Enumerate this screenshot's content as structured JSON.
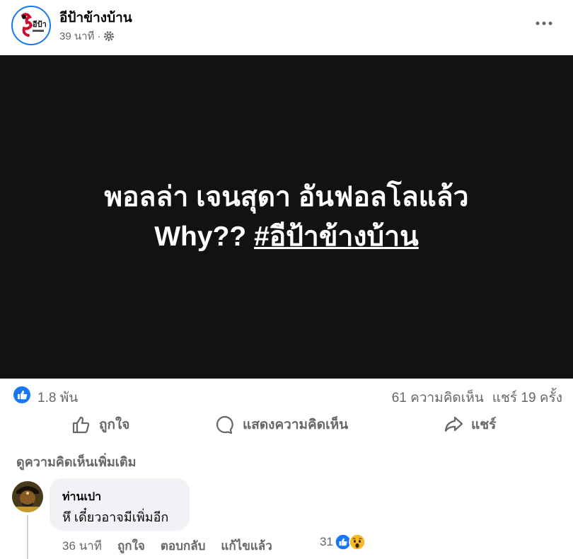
{
  "post": {
    "page_name": "อีป้าข้างบ้าน",
    "time": "39 นาที",
    "separator": "·",
    "avatar_text": "อีป้า"
  },
  "media": {
    "line1": "พอลล่า เจนสุดา อันฟอลโลแล้ว",
    "line2_text": "Why??",
    "hashtag": "#อีป้าข้างบ้าน"
  },
  "stats": {
    "likes": "1.8 พัน",
    "comments": "61 ความคิดเห็น",
    "shares": "แชร์ 19 ครั้ง"
  },
  "actions": {
    "like": "ถูกใจ",
    "comment": "แสดงความคิดเห็น",
    "share": "แชร์"
  },
  "more_comments": "ดูความคิดเห็นเพิ่มเติม",
  "comment": {
    "author": "ท่านเปา",
    "text": "หึ เดี๋ยวอาจมีเพิ่มอีก",
    "time": "36 นาที",
    "like": "ถูกใจ",
    "reply": "ตอบกลับ",
    "edited": "แก้ไขแล้ว",
    "reaction_count": "31"
  },
  "colors": {
    "brand": "#1877f2",
    "secondary_text": "#65676b",
    "media_bg": "#121212",
    "bubble_bg": "#f0f2f5"
  }
}
